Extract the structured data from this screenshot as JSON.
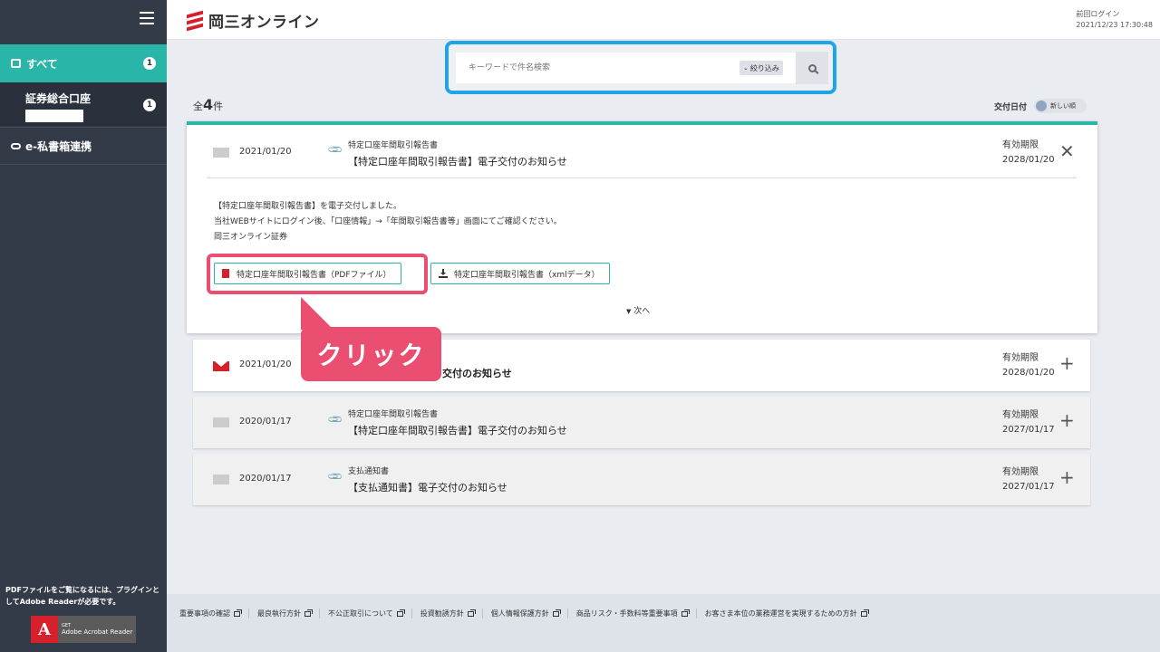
{
  "sidebar": {
    "all_label": "すべて",
    "all_count": "1",
    "account_label": "証券総合口座",
    "account_count": "1",
    "link_label": "e-私書箱連携",
    "note": "PDFファイルをご覧になるには、プラグインとしてAdobe Readerが必要です。",
    "adobe_get": "GET",
    "adobe_name": "Adobe Acrobat Reader"
  },
  "header": {
    "logo_text": "岡三オンライン",
    "last_login_label": "前回ログイン",
    "last_login_time": "2021/12/23 17:30:48"
  },
  "search": {
    "placeholder": "キーワードで件名検索",
    "filter_label": "絞り込み"
  },
  "list": {
    "count_prefix": "全",
    "count_value": "4",
    "count_suffix": "件",
    "sort_label": "交付日付",
    "sort_toggle": "新しい順"
  },
  "items": [
    {
      "date": "2021/01/20",
      "doc_type": "特定口座年間取引報告書",
      "subject": "【特定口座年間取引報告書】電子交付のお知らせ",
      "valid_label": "有効期限",
      "valid_date": "2028/01/20",
      "body": [
        "【特定口座年間取引報告書】を電子交付しました。",
        "当社WEBサイトにログイン後、「口座情報」→「年間取引報告書等」画面にてご確認ください。",
        "岡三オンライン証券"
      ],
      "pdf_button": "特定口座年間取引報告書（PDFファイル）",
      "xml_button": "特定口座年間取引報告書（xmlデータ）",
      "next_label": "次へ"
    },
    {
      "date": "2021/01/20",
      "subject_visible": "交付のお知らせ",
      "valid_label": "有効期限",
      "valid_date": "2028/01/20"
    },
    {
      "date": "2020/01/17",
      "doc_type": "特定口座年間取引報告書",
      "subject": "【特定口座年間取引報告書】電子交付のお知らせ",
      "valid_label": "有効期限",
      "valid_date": "2027/01/17"
    },
    {
      "date": "2020/01/17",
      "doc_type": "支払通知書",
      "subject": "【支払通知書】電子交付のお知らせ",
      "valid_label": "有効期限",
      "valid_date": "2027/01/17"
    }
  ],
  "callout": "クリック",
  "footer": {
    "links": [
      "重要事項の確認",
      "最良執行方針",
      "不公正取引について",
      "投資勧誘方針",
      "個人情報保護方針",
      "商品リスク・手数料等重要事項",
      "お客さま本位の業務運営を実現するための方針"
    ]
  },
  "colors": {
    "accent": "#29b6a8",
    "sidebar": "#343b48",
    "highlight": "#ea4e71",
    "search_frame": "#1ea4e9",
    "brand_red": "#d6202b"
  }
}
